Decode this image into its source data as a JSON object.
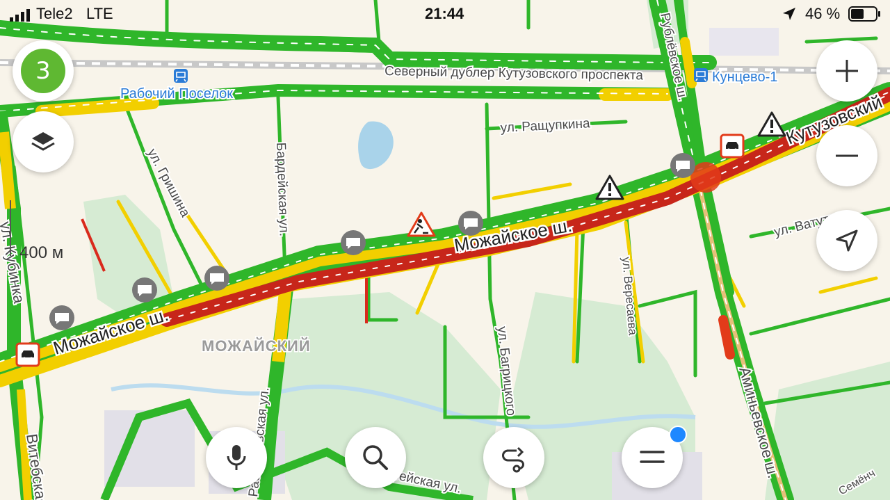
{
  "status_bar": {
    "carrier": "Tele2",
    "network": "LTE",
    "time": "21:44",
    "battery": "46 %"
  },
  "traffic_score": "3",
  "scale": "400 м",
  "map_labels": {
    "northern_backup": "Северный дублер Кутузовского проспекта",
    "station_rabochiy": "Рабочий Поселок",
    "station_kuntsevo": "Кунцево-1",
    "rubl": "Рублёвское ш.",
    "kutuz": "Кутузовский",
    "rashchupkina": "ул. Ращупкина",
    "grishina": "ул. Гришина",
    "bardeyskaya": "Бардейская ул.",
    "mozh1": "Можайское ш.",
    "mozh2": "Можайское ш.",
    "kubinka": "ул. Кубинка",
    "vatutina": "ул. Ватутина",
    "veresaeva": "ул. Вересаева",
    "bagritskogo": "ул. Багрицкого",
    "district": "МОЖАЙСКИЙ",
    "vitebskaya": "Витебская",
    "aminyevskoe": "Аминьевское ш.",
    "rabfak": "Рабфаковская ул.",
    "vereyskaya": "Верейская ул.",
    "semenych": "Семёнч"
  },
  "colors": {
    "green": "#2fb62a",
    "yellow": "#f2cf00",
    "red": "#e23b1a",
    "darkred": "#b0180e",
    "water": "#a9d3ea",
    "park": "#d3ead1",
    "blue_label": "#2a7bd6"
  },
  "icons": {
    "location": "location-arrow-icon",
    "layers": "layers-icon",
    "zoom_in": "plus-icon",
    "zoom_out": "minus-icon",
    "navigate": "navigation-arrow-icon",
    "mic": "microphone-icon",
    "search": "search-icon",
    "route": "route-icon",
    "menu": "menu-icon",
    "railway_station": "train-station-icon",
    "road_work": "road-work-icon",
    "warning": "warning-icon",
    "accident": "accident-icon",
    "chat": "chat-bubble-icon"
  }
}
